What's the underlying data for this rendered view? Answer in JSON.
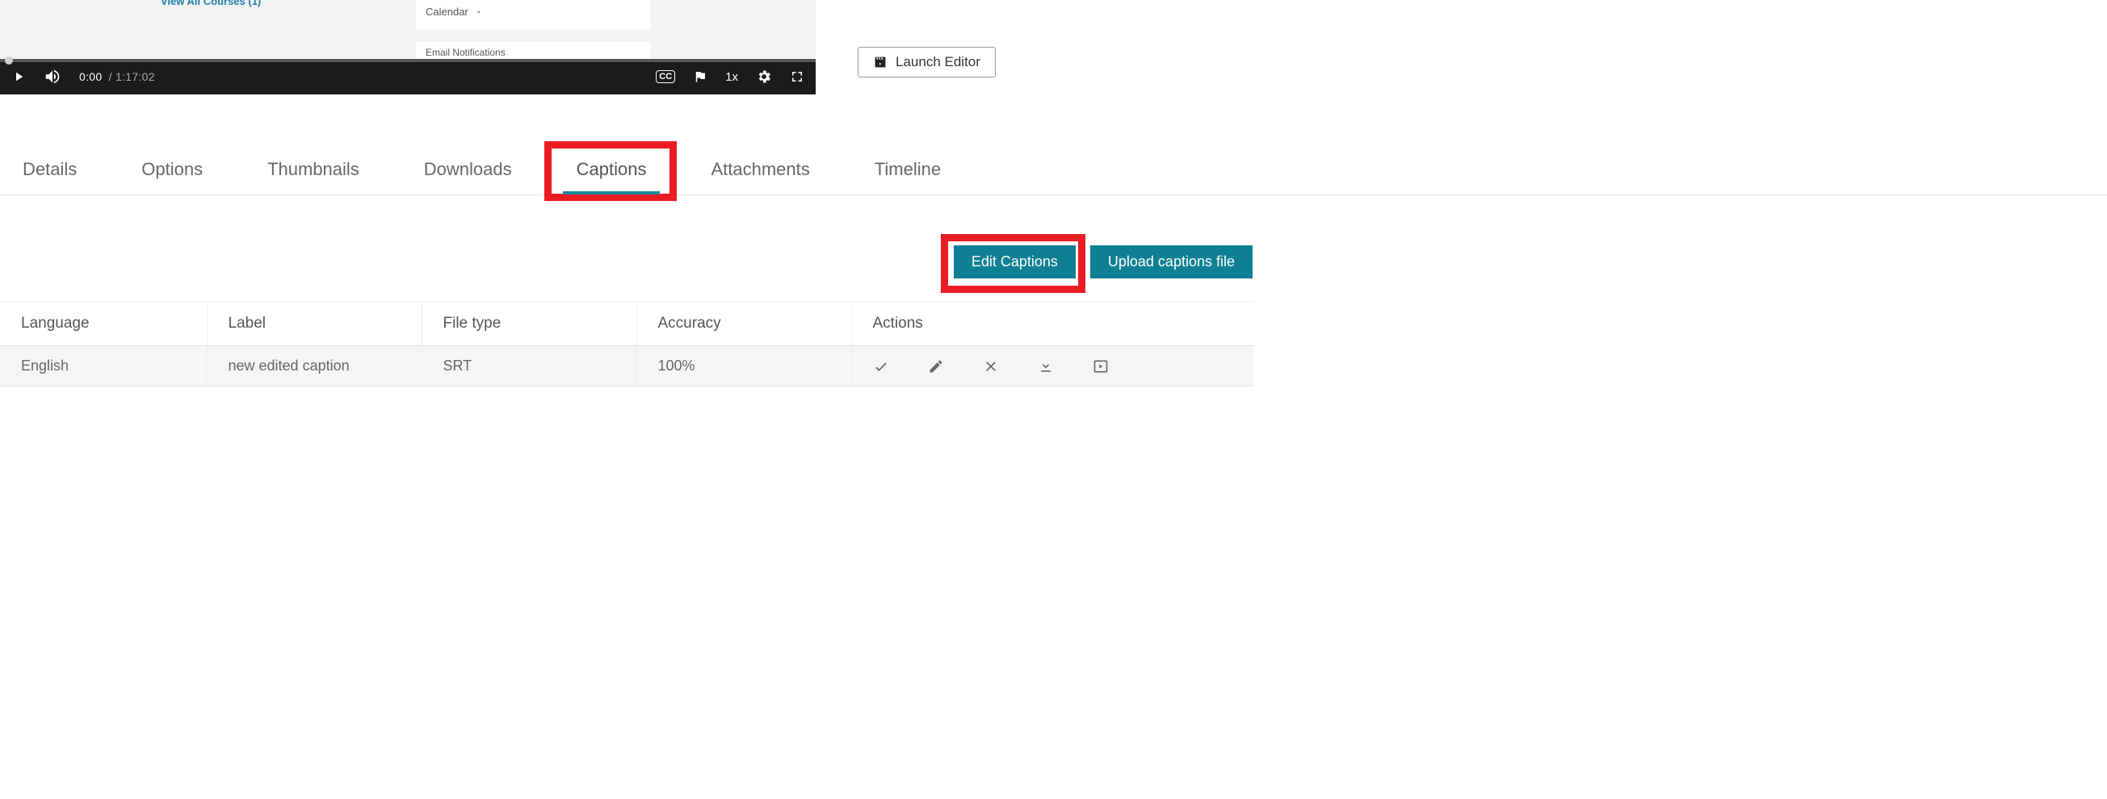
{
  "video": {
    "link_label": "View All Courses (1)",
    "panel1_label": "Calendar",
    "panel2_label": "Email Notifications",
    "current_time": "0:00",
    "duration": "/ 1:17:02",
    "speed": "1x"
  },
  "launch_editor_label": "Launch Editor",
  "tabs": [
    {
      "label": "Details",
      "active": false,
      "highlighted": false
    },
    {
      "label": "Options",
      "active": false,
      "highlighted": false
    },
    {
      "label": "Thumbnails",
      "active": false,
      "highlighted": false
    },
    {
      "label": "Downloads",
      "active": false,
      "highlighted": false
    },
    {
      "label": "Captions",
      "active": true,
      "highlighted": true
    },
    {
      "label": "Attachments",
      "active": false,
      "highlighted": false
    },
    {
      "label": "Timeline",
      "active": false,
      "highlighted": false
    }
  ],
  "buttons": {
    "edit_captions": "Edit Captions",
    "upload_captions": "Upload captions file"
  },
  "table": {
    "headers": {
      "language": "Language",
      "label": "Label",
      "file_type": "File type",
      "accuracy": "Accuracy",
      "actions": "Actions"
    },
    "row": {
      "language": "English",
      "label": "new edited caption",
      "file_type": "SRT",
      "accuracy": "100%"
    }
  }
}
